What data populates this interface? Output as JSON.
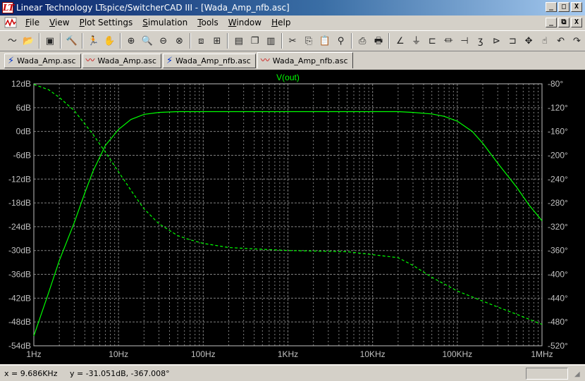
{
  "window": {
    "title": "Linear Technology LTspice/SwitcherCAD III - [Wada_Amp_nfb.asc]",
    "app_icon": "ltspice-logo-icon",
    "buttons": [
      "_",
      "□",
      "X"
    ]
  },
  "menu": {
    "items": [
      {
        "label": "File",
        "key": "F"
      },
      {
        "label": "View",
        "key": "V"
      },
      {
        "label": "Plot Settings",
        "key": "P"
      },
      {
        "label": "Simulation",
        "key": "S"
      },
      {
        "label": "Tools",
        "key": "T"
      },
      {
        "label": "Window",
        "key": "W"
      },
      {
        "label": "Help",
        "key": "H"
      }
    ],
    "mdi_buttons": [
      "_",
      "⧉",
      "X"
    ]
  },
  "toolbar": {
    "groups": [
      [
        "waveform-icon",
        "open-icon"
      ],
      [
        "save-icon"
      ],
      [
        "control-panel-icon"
      ],
      [
        "run-icon",
        "halt-icon"
      ],
      [
        "zoom-in-icon",
        "zoom-area-icon",
        "zoom-out-icon",
        "zoom-cancel-icon"
      ],
      [
        "autorange-icon",
        "autorange-y-icon"
      ],
      [
        "tile-horizontal-icon",
        "cascade-icon",
        "tile-vertical-icon"
      ],
      [
        "cut-icon",
        "copy-icon",
        "paste-icon",
        "find-icon"
      ],
      [
        "print-icon",
        "print-preview-icon"
      ],
      [
        "wire-icon",
        "ground-icon",
        "label-icon",
        "resistor-icon",
        "capacitor-icon",
        "inductor-icon",
        "diode-icon",
        "component-icon",
        "move-icon",
        "drag-icon",
        "undo-icon",
        "redo-icon"
      ]
    ]
  },
  "tabs": [
    {
      "label": "Wada_Amp.asc",
      "icon": "schematic-icon",
      "kind": "sch",
      "active": false
    },
    {
      "label": "Wada_Amp.asc",
      "icon": "waveform-icon",
      "kind": "wave",
      "active": false
    },
    {
      "label": "Wada_Amp_nfb.asc",
      "icon": "schematic-icon",
      "kind": "sch",
      "active": false
    },
    {
      "label": "Wada_Amp_nfb.asc",
      "icon": "waveform-icon",
      "kind": "wave",
      "active": true
    }
  ],
  "status": {
    "cursor_text": "x = 9.686KHz     y = -31.051dB, -367.008°"
  },
  "colors": {
    "plot_background": "#000000",
    "trace": "#00ff00",
    "grid": "#808080",
    "axis_text": "#c0c0c0"
  },
  "chart_data": {
    "type": "line",
    "title": "V(out)",
    "xscale": "log",
    "x_ticks": [
      {
        "value": 1,
        "label": "1Hz"
      },
      {
        "value": 10,
        "label": "10Hz"
      },
      {
        "value": 100,
        "label": "100Hz"
      },
      {
        "value": 1000,
        "label": "1KHz"
      },
      {
        "value": 10000,
        "label": "10KHz"
      },
      {
        "value": 100000,
        "label": "100KHz"
      },
      {
        "value": 1000000,
        "label": "1MHz"
      }
    ],
    "xlim": [
      1,
      1000000
    ],
    "y_left": {
      "unit": "dB",
      "ylim": [
        -54,
        12
      ],
      "ticks": [
        12,
        6,
        0,
        -6,
        -12,
        -18,
        -24,
        -30,
        -36,
        -42,
        -48,
        -54
      ],
      "tick_labels": [
        "12dB",
        "6dB",
        "0dB",
        "-6dB",
        "-12dB",
        "-18dB",
        "-24dB",
        "-30dB",
        "-36dB",
        "-42dB",
        "-48dB",
        "-54dB"
      ]
    },
    "y_right": {
      "unit": "°",
      "ylim": [
        -520,
        -80
      ],
      "ticks": [
        -80,
        -120,
        -160,
        -200,
        -240,
        -280,
        -320,
        -360,
        -400,
        -440,
        -480,
        -520
      ],
      "tick_labels": [
        "-80°",
        "-120°",
        "-160°",
        "-200°",
        "-240°",
        "-280°",
        "-320°",
        "-360°",
        "-400°",
        "-440°",
        "-480°",
        "-520°"
      ]
    },
    "series": [
      {
        "name": "V(out)",
        "style": "solid",
        "axis": "left",
        "points": [
          [
            1,
            -51.5
          ],
          [
            1.5,
            -40.5
          ],
          [
            2,
            -32.5
          ],
          [
            3,
            -23
          ],
          [
            4,
            -15.5
          ],
          [
            5,
            -10
          ],
          [
            7,
            -3.5
          ],
          [
            10,
            0.5
          ],
          [
            14,
            3
          ],
          [
            20,
            4.3
          ],
          [
            30,
            4.8
          ],
          [
            50,
            5
          ],
          [
            100,
            5
          ],
          [
            1000,
            5
          ],
          [
            10000,
            5
          ],
          [
            20000,
            5
          ],
          [
            30000,
            4.8
          ],
          [
            50000,
            4.4
          ],
          [
            70000,
            3.8
          ],
          [
            100000,
            2.6
          ],
          [
            150000,
            0
          ],
          [
            200000,
            -3
          ],
          [
            300000,
            -8
          ],
          [
            500000,
            -14
          ],
          [
            700000,
            -18.5
          ],
          [
            1000000,
            -22.5
          ]
        ]
      },
      {
        "name": "phase",
        "style": "dashed",
        "axis": "right",
        "points": [
          [
            1,
            -81
          ],
          [
            1.5,
            -90
          ],
          [
            2,
            -103
          ],
          [
            3,
            -125
          ],
          [
            5,
            -165
          ],
          [
            7,
            -195
          ],
          [
            10,
            -228
          ],
          [
            15,
            -265
          ],
          [
            20,
            -290
          ],
          [
            30,
            -315
          ],
          [
            50,
            -335
          ],
          [
            70,
            -342
          ],
          [
            100,
            -348
          ],
          [
            200,
            -355
          ],
          [
            500,
            -358
          ],
          [
            1000,
            -360
          ],
          [
            5000,
            -362
          ],
          [
            10000,
            -367
          ],
          [
            20000,
            -372
          ],
          [
            30000,
            -385
          ],
          [
            50000,
            -405
          ],
          [
            100000,
            -428
          ],
          [
            200000,
            -445
          ],
          [
            300000,
            -455
          ],
          [
            500000,
            -467
          ],
          [
            1000000,
            -484
          ]
        ]
      }
    ],
    "grid": true
  }
}
